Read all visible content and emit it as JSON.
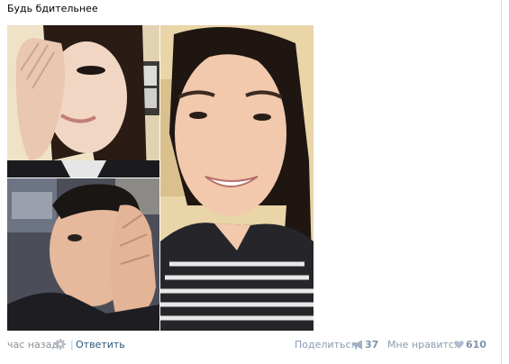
{
  "post": {
    "text": "Будь бдительнее"
  },
  "photos": [
    {
      "name": "photo-woman-covering-eye"
    },
    {
      "name": "photo-man-covering-eye"
    },
    {
      "name": "photo-smiling-person-long-hair"
    }
  ],
  "footer": {
    "time": "час назад",
    "separator": "|",
    "reply_label": "Ответить",
    "share_label": "Поделиться",
    "share_count": "37",
    "like_label": "Мне нравится",
    "like_count": "610"
  },
  "icons": {
    "settings": "gear-icon",
    "share": "megaphone-icon",
    "like": "heart-icon"
  },
  "colors": {
    "link": "#2b587a",
    "muted": "#8a8f96",
    "counter": "#7f95ad"
  }
}
